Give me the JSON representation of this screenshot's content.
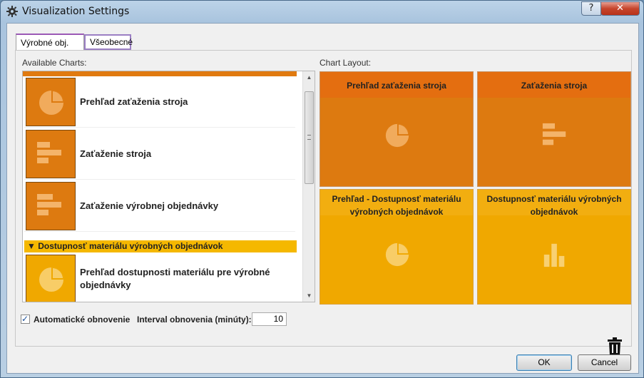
{
  "window": {
    "title": "Visualization Settings",
    "help_label": "?",
    "close_label": "✕"
  },
  "tabs": [
    {
      "label": "Výrobné obj.",
      "active": true
    },
    {
      "label": "Všeobecné",
      "active": false
    }
  ],
  "available": {
    "label": "Available Charts:",
    "group_caret": "▼",
    "items": [
      {
        "label": "Prehľad zaťaženia stroja",
        "icon": "pie-chart-icon",
        "color": "#dd7a10"
      },
      {
        "label": "Zaťaženie stroja",
        "icon": "bar-horizontal-icon",
        "color": "#dd7a10"
      },
      {
        "label": "Zaťaženie výrobnej objednávky",
        "icon": "bar-horizontal-icon",
        "color": "#dd7a10"
      },
      {
        "label": "Prehľad dostupnosti materiálu pre výrobné objednávky",
        "icon": "pie-chart-icon",
        "color": "#f0a800"
      }
    ],
    "group_label": "Dostupnosť materiálu výrobných objednávok"
  },
  "layout": {
    "label": "Chart Layout:",
    "tiles": [
      {
        "title": "Prehľad zaťaženia stroja",
        "icon": "pie-chart-icon",
        "color": "#dd7a10"
      },
      {
        "title": "Zaťaženia stroja",
        "icon": "bar-horizontal-icon",
        "color": "#dd7a10"
      },
      {
        "title": "Prehľad - Dostupnosť materiálu výrobných objednávok",
        "icon": "pie-chart-icon",
        "color": "#f0a800"
      },
      {
        "title": "Dostupnosť materiálu výrobných objednávok",
        "icon": "bar-vertical-icon",
        "color": "#f0a800"
      }
    ]
  },
  "footer": {
    "auto_refresh_label": "Automatické obnovenie",
    "auto_refresh_checked": true,
    "interval_label": "Interval obnovenia (minúty):",
    "interval_value": "10",
    "ok_label": "OK",
    "cancel_label": "Cancel"
  }
}
